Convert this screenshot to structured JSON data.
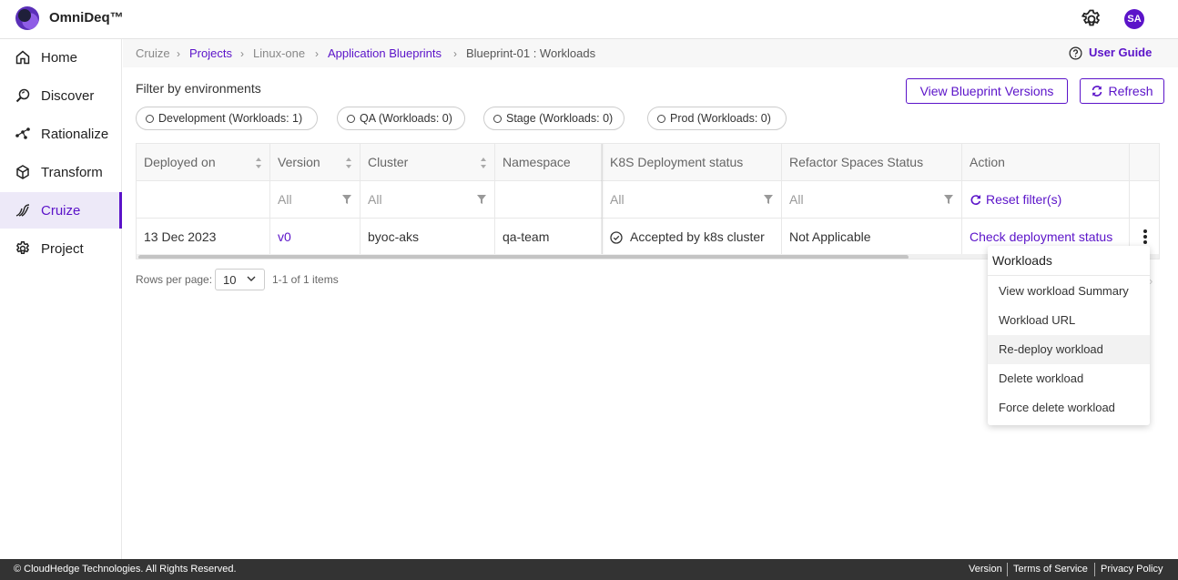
{
  "app": {
    "brand": "OmniDeq™",
    "avatar_initials": "SA"
  },
  "sidebar": {
    "items": [
      {
        "label": "Home",
        "icon": "home-icon"
      },
      {
        "label": "Discover",
        "icon": "discover-icon"
      },
      {
        "label": "Rationalize",
        "icon": "rationalize-icon"
      },
      {
        "label": "Transform",
        "icon": "transform-icon"
      },
      {
        "label": "Cruize",
        "icon": "cruize-icon",
        "active": true
      },
      {
        "label": "Project",
        "icon": "gear-icon"
      }
    ]
  },
  "breadcrumb": {
    "items": [
      "Cruize",
      "Projects",
      "Linux-one",
      "Application Blueprints",
      "Blueprint-01 : Workloads"
    ],
    "user_guide": "User Guide"
  },
  "filters": {
    "title": "Filter by environments",
    "chips": [
      "Development (Workloads: 1)",
      "QA (Workloads: 0)",
      "Stage (Workloads: 0)",
      "Prod (Workloads: 0)"
    ]
  },
  "actions": {
    "view_versions": "View Blueprint Versions",
    "refresh": "Refresh"
  },
  "table": {
    "headers": [
      "Deployed on",
      "Version",
      "Cluster",
      "Namespace",
      "K8S Deployment status",
      "Refactor Spaces Status",
      "Action"
    ],
    "filter_values": {
      "version": "All",
      "cluster": "All",
      "k8s": "All",
      "refactor": "All",
      "reset": "Reset filter(s)"
    },
    "rows": [
      {
        "deployed_on": "13 Dec 2023",
        "version": "v0",
        "cluster": "byoc-aks",
        "namespace": "qa-team",
        "k8s_status": "Accepted by k8s cluster",
        "refactor_status": "Not Applicable",
        "action": "Check deployment status"
      }
    ]
  },
  "pager": {
    "rows_label": "Rows per page:",
    "rows_value": "10",
    "count": "1-1 of 1 items"
  },
  "menu": {
    "title": "Workloads",
    "items": [
      "View workload Summary",
      "Workload URL",
      "Re-deploy workload",
      "Delete workload",
      "Force delete workload"
    ],
    "hovered_index": 2
  },
  "footer": {
    "copyright": "© CloudHedge Technologies. All Rights Reserved.",
    "links": [
      "Version",
      "Terms of Service",
      "Privacy Policy"
    ]
  },
  "colors": {
    "accent": "#5b13c9",
    "footer_bg": "#333333"
  }
}
